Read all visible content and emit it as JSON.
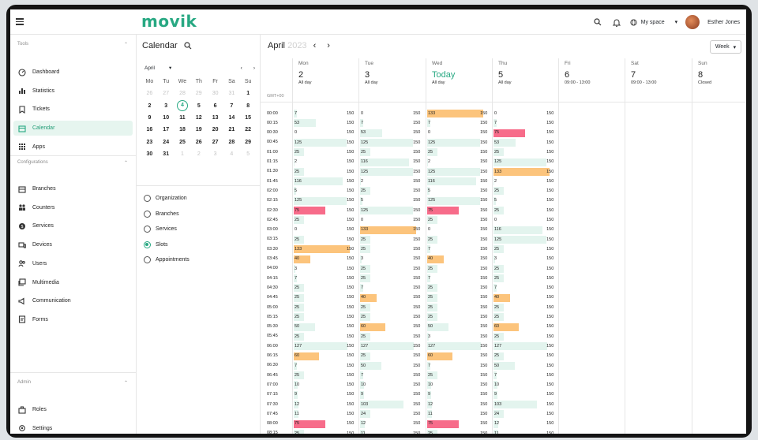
{
  "app": {
    "logo": "movik",
    "user_name": "Esther Jones",
    "space_label": "My space"
  },
  "colors": {
    "accent": "#27a882",
    "light": "#e3f4ee",
    "orange": "#fcc47c",
    "red": "#f76c8a"
  },
  "sidebar": {
    "section_tools": "Tools",
    "section_config": "Configurations",
    "section_admin": "Admin",
    "tools": [
      {
        "label": "Dashboard",
        "icon": "dashboard-icon"
      },
      {
        "label": "Statistics",
        "icon": "statistics-icon"
      },
      {
        "label": "Tickets",
        "icon": "tickets-icon"
      },
      {
        "label": "Calendar",
        "icon": "calendar-icon",
        "active": true
      },
      {
        "label": "Apps",
        "icon": "apps-icon"
      }
    ],
    "config": [
      {
        "label": "Branches",
        "icon": "branches-icon"
      },
      {
        "label": "Counters",
        "icon": "counters-icon"
      },
      {
        "label": "Services",
        "icon": "services-icon"
      },
      {
        "label": "Devices",
        "icon": "devices-icon"
      },
      {
        "label": "Users",
        "icon": "users-icon"
      },
      {
        "label": "Multimedia",
        "icon": "multimedia-icon"
      },
      {
        "label": "Communication",
        "icon": "communication-icon"
      },
      {
        "label": "Forms",
        "icon": "forms-icon"
      }
    ],
    "admin": [
      {
        "label": "Roles",
        "icon": "roles-icon"
      },
      {
        "label": "Settings",
        "icon": "settings-icon"
      }
    ]
  },
  "calendar_panel": {
    "title": "Calendar",
    "month_select": "April",
    "weekdays": [
      "Mo",
      "Tu",
      "We",
      "Th",
      "Fr",
      "Sa",
      "Su"
    ],
    "weeks": [
      [
        [
          "26",
          1
        ],
        [
          "27",
          1
        ],
        [
          "28",
          1
        ],
        [
          "29",
          1
        ],
        [
          "30",
          1
        ],
        [
          "31",
          1
        ],
        [
          "1",
          0
        ]
      ],
      [
        [
          "2",
          0
        ],
        [
          "3",
          0
        ],
        [
          "4",
          2
        ],
        [
          "5",
          0
        ],
        [
          "6",
          0
        ],
        [
          "7",
          0
        ],
        [
          "8",
          0
        ]
      ],
      [
        [
          "9",
          0
        ],
        [
          "10",
          0
        ],
        [
          "11",
          0
        ],
        [
          "12",
          0
        ],
        [
          "13",
          0
        ],
        [
          "14",
          0
        ],
        [
          "15",
          0
        ]
      ],
      [
        [
          "16",
          0
        ],
        [
          "17",
          0
        ],
        [
          "18",
          0
        ],
        [
          "19",
          0
        ],
        [
          "20",
          0
        ],
        [
          "21",
          0
        ],
        [
          "22",
          0
        ]
      ],
      [
        [
          "23",
          0
        ],
        [
          "24",
          0
        ],
        [
          "25",
          0
        ],
        [
          "26",
          0
        ],
        [
          "27",
          0
        ],
        [
          "28",
          0
        ],
        [
          "29",
          0
        ]
      ],
      [
        [
          "30",
          0
        ],
        [
          "31",
          0
        ],
        [
          "1",
          1
        ],
        [
          "2",
          1
        ],
        [
          "3",
          1
        ],
        [
          "4",
          1
        ],
        [
          "5",
          1
        ]
      ]
    ],
    "filters": [
      {
        "label": "Organization",
        "checked": false
      },
      {
        "label": "Branches",
        "checked": false
      },
      {
        "label": "Services",
        "checked": false
      },
      {
        "label": "Slots",
        "checked": true
      },
      {
        "label": "Appointments",
        "checked": false
      }
    ]
  },
  "main": {
    "month": "April",
    "year": "2023",
    "view_select": "Week",
    "timezone": "GMT+00",
    "days": [
      {
        "name": "Mon",
        "date": "2",
        "sub": "All day"
      },
      {
        "name": "Tue",
        "date": "3",
        "sub": "All day"
      },
      {
        "name": "Wed",
        "date": "Today",
        "sub": "All day",
        "today": true
      },
      {
        "name": "Thu",
        "date": "5",
        "sub": "All day"
      },
      {
        "name": "Fri",
        "date": "6",
        "sub": "09:00 - 13:00"
      },
      {
        "name": "Sat",
        "date": "7",
        "sub": "09:00 - 13:00"
      },
      {
        "name": "Sun",
        "date": "8",
        "sub": "Closed"
      }
    ],
    "slot_max": "150",
    "times": [
      "00:00",
      "00:15",
      "00:30",
      "00:45",
      "01:00",
      "01:15",
      "01:30",
      "01:45",
      "02:00",
      "02:15",
      "02:30",
      "02:45",
      "03:00",
      "03:15",
      "03:30",
      "03:45",
      "04:00",
      "04:15",
      "04:30",
      "04:45",
      "05:00",
      "05:15",
      "05:30",
      "05:45",
      "06:00",
      "06:15",
      "06:30",
      "06:45",
      "07:00",
      "07:15",
      "07:30",
      "07:45",
      "08:00",
      "08:15"
    ],
    "slots": {
      "mon": [
        7,
        53,
        0,
        125,
        25,
        2,
        25,
        116,
        5,
        125,
        75,
        25,
        0,
        25,
        133,
        40,
        3,
        7,
        25,
        25,
        25,
        25,
        50,
        25,
        127,
        60,
        7,
        25,
        10,
        9,
        12,
        11,
        75,
        25
      ],
      "tue": [
        0,
        7,
        53,
        125,
        25,
        116,
        125,
        2,
        25,
        5,
        125,
        0,
        133,
        25,
        25,
        3,
        25,
        25,
        7,
        40,
        25,
        25,
        60,
        25,
        127,
        25,
        50,
        7,
        10,
        9,
        103,
        24,
        12,
        11
      ],
      "wed": [
        133,
        7,
        0,
        125,
        25,
        2,
        125,
        116,
        5,
        125,
        75,
        25,
        0,
        25,
        7,
        40,
        25,
        7,
        25,
        25,
        25,
        25,
        50,
        3,
        127,
        60,
        7,
        25,
        10,
        9,
        12,
        11,
        75,
        25
      ],
      "thu": [
        0,
        7,
        75,
        53,
        25,
        125,
        133,
        2,
        25,
        5,
        25,
        0,
        116,
        125,
        25,
        3,
        25,
        25,
        7,
        40,
        25,
        25,
        60,
        25,
        127,
        25,
        50,
        7,
        10,
        9,
        103,
        24,
        12,
        11
      ]
    }
  }
}
